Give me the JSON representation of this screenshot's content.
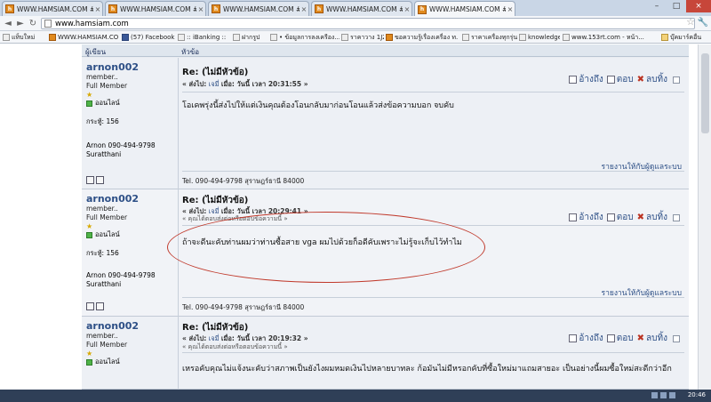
{
  "browser": {
    "tabs": [
      {
        "title": "WWW.HAMSIAM.COM # NO",
        "active": false
      },
      {
        "title": "WWW.HAMSIAM.COM # NO",
        "active": false
      },
      {
        "title": "WWW.HAMSIAM.COM # NO",
        "active": false
      },
      {
        "title": "WWW.HAMSIAM.COM # NO",
        "active": false
      },
      {
        "title": "WWW.HAMSIAM.COM # NO",
        "active": true
      }
    ],
    "tab_close": "×",
    "minimize": "–",
    "maximize": "□",
    "close": "×",
    "url": "www.hamsiam.com",
    "back": "◄",
    "forward": "►",
    "reload": "↻",
    "star": "☆",
    "wrench": "🔧",
    "bookmarks": [
      {
        "label": "แท็บใหม่",
        "icon": "page"
      },
      {
        "label": "WWW.HAMSIAM.COM...",
        "icon": "orange"
      },
      {
        "label": "(57) Facebook",
        "icon": "fb"
      },
      {
        "label": ":: iBanking ::",
        "icon": "page"
      },
      {
        "label": "ฝากรูป",
        "icon": "page"
      },
      {
        "label": "• ข้อมูลการลงเครือง...",
        "icon": "page"
      },
      {
        "label": "ราคาวาง 1JZ",
        "icon": "page"
      },
      {
        "label": "ขอความรู้เรื่องเครื่อง ท...",
        "icon": "orange"
      },
      {
        "label": "ราคาเครื่องทุกรุ่น",
        "icon": "page"
      },
      {
        "label": "knowledge",
        "icon": "page"
      },
      {
        "label": "www.153rt.com - หน้า...",
        "icon": "page"
      },
      {
        "label": "บุ๊คมาร์คอื่น",
        "icon": "folder"
      }
    ]
  },
  "forum": {
    "col_author": "ผู้เขียน",
    "col_topic": "หัวข้อ",
    "posts": [
      {
        "user": "arnon002",
        "rank": "member..",
        "group": "Full Member",
        "star": "★",
        "online": "ออนไลน์",
        "post_count": "กระทู้: 156",
        "sig_name": "Arnon 090-494-9798",
        "sig_city": "Suratthani",
        "title": "Re: (ไม่มีหัวข้อ)",
        "meta_prefix": "« ส่งไป:",
        "meta_user": "เจมี่",
        "meta_rest": "เมื่อ: วันนี้ เวลา 20:31:55 »",
        "quote_note": "",
        "body": "โอเคพรุ่งนี้ส่งไปให้แต่เงินคุณต้องโอนกลับมาก่อนโอนแล้วส่งข้อความบอก จบคับ",
        "quote": "อ้างถึง",
        "reply": "ตอบ",
        "delete": "ลบทิ้ง",
        "report": "รายงานให้กับผู้ดูแลระบบ",
        "footer": "Tel. 090-494-9798 สุราษฎร์ธานี 84000"
      },
      {
        "user": "arnon002",
        "rank": "member..",
        "group": "Full Member",
        "star": "★",
        "online": "ออนไลน์",
        "post_count": "กระทู้: 156",
        "sig_name": "Arnon 090-494-9798",
        "sig_city": "Suratthani",
        "title": "Re: (ไม่มีหัวข้อ)",
        "meta_prefix": "« ส่งไป:",
        "meta_user": "เจมี่",
        "meta_rest": "เมื่อ: วันนี้ เวลา 20:29:41 »",
        "quote_note": "« คุณได้ตอบส่งต่อหรือตอบข้อความนี้ »",
        "body": "ถ้าจะดีนะคับท่านผมว่าท่านซื้อสาย vga ผมไปด้วยก็อดีคับเพราะไม่รู้จะเก็บไว้ทำไม",
        "quote": "อ้างถึง",
        "reply": "ตอบ",
        "delete": "ลบทิ้ง",
        "report": "รายงานให้กับผู้ดูแลระบบ",
        "footer": "Tel. 090-494-9798 สุราษฎร์ธานี 84000"
      },
      {
        "user": "arnon002",
        "rank": "member..",
        "group": "Full Member",
        "star": "★",
        "online": "ออนไลน์",
        "post_count": "",
        "sig_name": "",
        "sig_city": "",
        "title": "Re: (ไม่มีหัวข้อ)",
        "meta_prefix": "« ส่งไป:",
        "meta_user": "เจมี่",
        "meta_rest": "เมื่อ: วันนี้ เวลา 20:19:32 »",
        "quote_note": "« คุณได้ตอบส่งต่อหรือตอบข้อความนี้ »",
        "body": "เหรอคับคุณไม่แจ้งนะคับว่าสภาพเป็นยังไงผมหมดเงินไปหลายบาทละ ก้อมันไม่มีหรอกคับที่ซื้อใหม่มาแถมสายอะ เป็นอย่างนี้ผมซื้อใหม่สะดีกว่าอีก",
        "quote": "อ้างถึง",
        "reply": "ตอบ",
        "delete": "ลบทิ้ง",
        "report": "",
        "footer": ""
      }
    ]
  },
  "taskbar": {
    "time": "20:46"
  }
}
